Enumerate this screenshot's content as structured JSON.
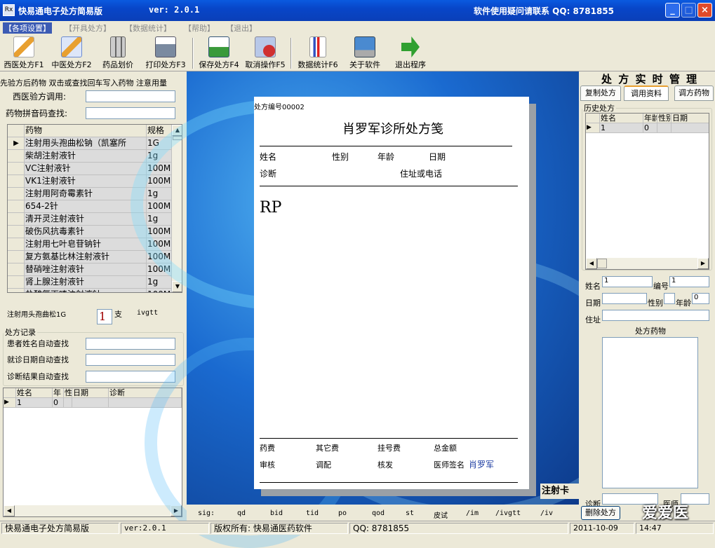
{
  "window": {
    "title": "快易通电子处方简易版",
    "version": "ver: 2.0.1",
    "contact": "软件使用疑问请联系 QQ: 8781855"
  },
  "menu": [
    "【各项设置】",
    "【开具处方】",
    "【数据统计】",
    "【帮助】",
    "【退出】"
  ],
  "toolbar": [
    {
      "label": "西医处方F1",
      "icon": "western-prescription-icon",
      "color": "#e8a030"
    },
    {
      "label": "中医处方F2",
      "icon": "chinese-prescription-icon",
      "color": "#6a8ad0"
    },
    {
      "label": "药品划价",
      "icon": "calculator-icon",
      "color": "#888"
    },
    {
      "label": "打印处方F3",
      "icon": "printer-icon",
      "color": "#7a8aa0"
    },
    {
      "label": "保存处方F4",
      "icon": "save-icon",
      "color": "#3a9a3a"
    },
    {
      "label": "取消操作F5",
      "icon": "cancel-icon",
      "color": "#d03030"
    },
    {
      "label": "数据统计F6",
      "icon": "chart-icon",
      "color": "#c09020"
    },
    {
      "label": "关于软件",
      "icon": "laptop-icon",
      "color": "#4a8ad0"
    },
    {
      "label": "退出程序",
      "icon": "exit-arrow-icon",
      "color": "#30a030"
    }
  ],
  "left": {
    "hint": "先验方后药物 双击或查找回车写入药物 注意用量",
    "template_label": "西医验方调用:",
    "pinyin_label": "药物拼音码查找:",
    "drug_headers": [
      "药物",
      "规格"
    ],
    "drugs": [
      [
        "注射用头孢曲松钠（凯塞所",
        "1G"
      ],
      [
        "柴胡注射液针",
        "1g"
      ],
      [
        "VC注射液针",
        "100M"
      ],
      [
        "VK1注射液针",
        "100M"
      ],
      [
        "注射用阿奇霉素针",
        "1g"
      ],
      [
        "654-2针",
        "100M"
      ],
      [
        "清开灵注射液针",
        "1g"
      ],
      [
        "破伤风抗毒素针",
        "100M"
      ],
      [
        "注射用七叶皂苷钠针",
        "100M"
      ],
      [
        "复方氨基比林注射液针",
        "100M"
      ],
      [
        "替硝唑注射液针",
        "100M"
      ],
      [
        "肾上腺注射液针",
        "1g"
      ],
      [
        "盐酸氯丙嗪注射液针",
        "100M"
      ]
    ],
    "selected_drug": "注射用头孢曲松1G",
    "qty": "1",
    "unit": "支",
    "route": "ivgtt",
    "records_legend": "处方记录",
    "patient_search_label": "患者姓名自动查找",
    "date_search_label": "就诊日期自动查找",
    "diag_search_label": "诊断结果自动查找",
    "record_headers": [
      "姓名",
      "年",
      "性",
      "日期",
      "诊断"
    ],
    "record_row": [
      "1",
      "0",
      "",
      "",
      ""
    ]
  },
  "paper": {
    "rx_no": "处方编号00002",
    "clinic": "肖罗军诊所处方笺",
    "name": "姓名",
    "gender": "性别",
    "age": "年龄",
    "date": "日期",
    "diagnosis": "诊断",
    "address": "住址或电话",
    "rp": "RP",
    "drug_fee": "药费",
    "other_fee": "其它费",
    "reg_fee": "挂号费",
    "total": "总金额",
    "review": "审核",
    "dispense": "调配",
    "verify": "核发",
    "doctor_label": "医师签名",
    "doctor": "肖罗军"
  },
  "injection_card": "注射卡",
  "shortcuts": [
    "sig:",
    "qd",
    "bid",
    "tid",
    "po",
    "qod",
    "st",
    "皮试",
    "/im",
    "/ivgtt",
    "/iv"
  ],
  "right": {
    "title": "处 方 实 时 管 理",
    "tabs": [
      "复制处方",
      "调用资料",
      "调方药物"
    ],
    "history_legend": "历史处方",
    "history_headers": [
      "姓名",
      "年龄",
      "性别",
      "日期"
    ],
    "history_row": [
      "1",
      "0",
      "",
      ""
    ],
    "name_label": "姓名",
    "name_value": "1",
    "no_label": "编号",
    "no_value": "1",
    "date_label": "日期",
    "gender_label": "性别",
    "age_label": "年龄",
    "age_value": "0",
    "address_label": "住址",
    "drugs_label": "处方药物",
    "diag_label": "诊断",
    "doctor_label": "医师",
    "delete_button": "删除处方",
    "watermark": "爱爱医"
  },
  "status": {
    "app": "快易通电子处方简易版",
    "version": "ver:2.0.1",
    "copyright": "版权所有: 快易通医药软件",
    "qq": "QQ: 8781855",
    "date": "2011-10-09",
    "time": "14:47"
  }
}
